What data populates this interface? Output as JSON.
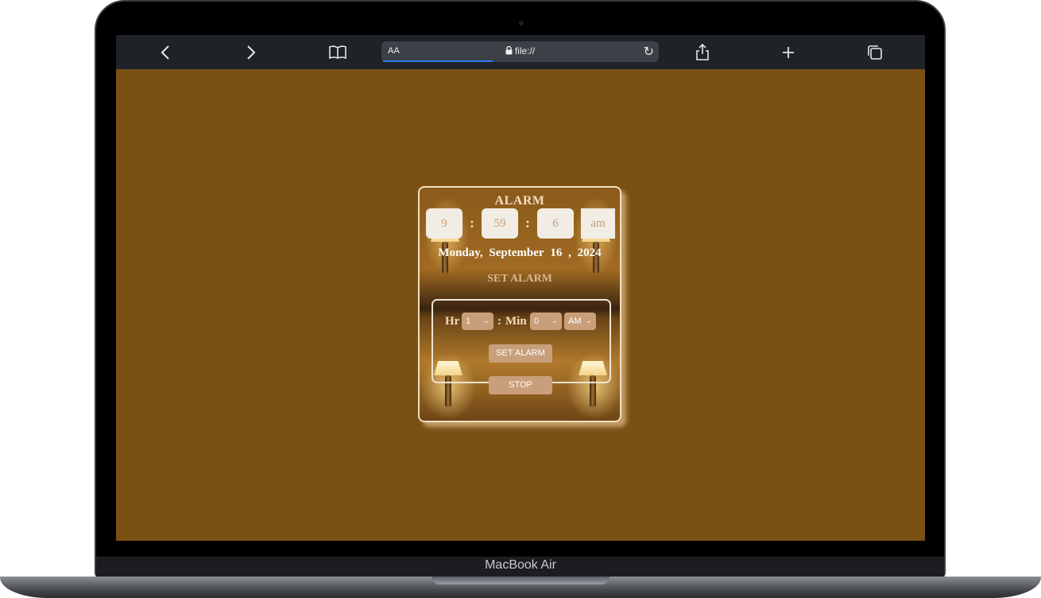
{
  "device": {
    "model": "MacBook Air"
  },
  "browser": {
    "text_size_label": "AA",
    "url": "file://",
    "icons": {
      "back": "chevron-left-icon",
      "forward": "chevron-right-icon",
      "bookmarks": "book-icon",
      "lock": "lock-icon",
      "reload": "reload-icon",
      "share": "share-icon",
      "new_tab": "plus-icon",
      "tabs": "tabs-icon"
    }
  },
  "alarm": {
    "title": "ALARM",
    "time": {
      "hour": "9",
      "minute": "59",
      "second": "6",
      "period": "am"
    },
    "separator": ":",
    "date": {
      "weekday": "Monday,",
      "month": "September",
      "day": "16",
      "comma": ",",
      "year": "2024"
    },
    "set_title": "SET ALARM",
    "form": {
      "hr_label": "Hr",
      "min_label": "Min",
      "hour_value": "1",
      "minute_value": "0",
      "period_value": "AM",
      "set_button": "SET ALARM",
      "stop_button": "STOP"
    }
  },
  "colors": {
    "page_background": "#7a5013",
    "time_box": "#f1ece4",
    "accent": "#c89f7a",
    "card_border": "#f2dfbf"
  }
}
